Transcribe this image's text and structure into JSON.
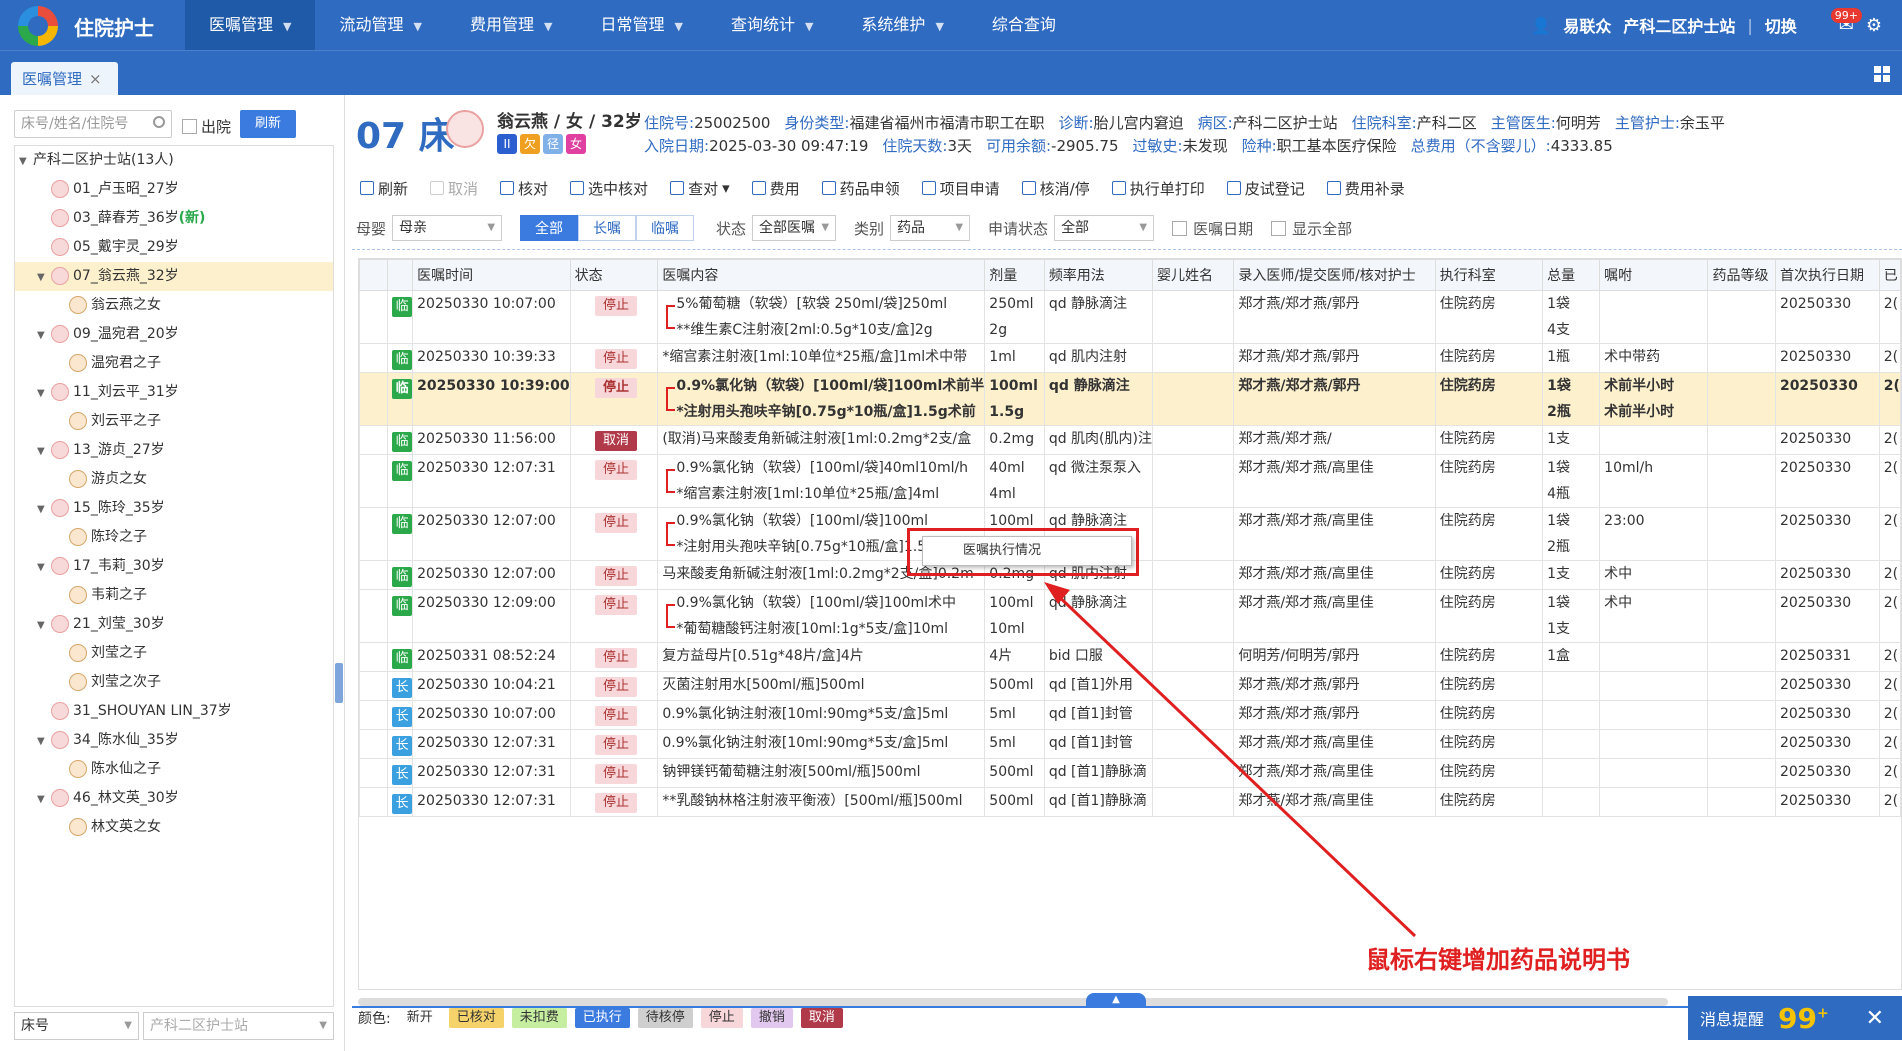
{
  "app": {
    "title": "住院护士",
    "user": "易联众",
    "ward": "产科二区护士站",
    "switch": "切换",
    "sep": "|",
    "msg_badge": "99+"
  },
  "nav": [
    "医嘱管理",
    "流动管理",
    "费用管理",
    "日常管理",
    "查询统计",
    "系统维护",
    "综合查询"
  ],
  "tab": {
    "label": "医嘱管理"
  },
  "sidebar": {
    "search_placeholder": "床号/姓名/住院号",
    "discharge_label": "出院",
    "refresh_label": "刷新",
    "root": "产科二区护士站(13人)",
    "nodes": [
      {
        "label": "01_卢玉昭_27岁",
        "level": 1
      },
      {
        "label": "03_薛春芳_36岁",
        "level": 1,
        "new": "(新)"
      },
      {
        "label": "05_戴宇灵_29岁",
        "level": 1
      },
      {
        "label": "07_翁云燕_32岁",
        "level": 1,
        "expanded": true,
        "selected": true
      },
      {
        "label": "翁云燕之女",
        "level": 2
      },
      {
        "label": "09_温宛君_20岁",
        "level": 1,
        "expanded": true
      },
      {
        "label": "温宛君之子",
        "level": 2
      },
      {
        "label": "11_刘云平_31岁",
        "level": 1,
        "expanded": true
      },
      {
        "label": "刘云平之子",
        "level": 2
      },
      {
        "label": "13_游贞_27岁",
        "level": 1,
        "expanded": true
      },
      {
        "label": "游贞之女",
        "level": 2
      },
      {
        "label": "15_陈玲_35岁",
        "level": 1,
        "expanded": true
      },
      {
        "label": "陈玲之子",
        "level": 2
      },
      {
        "label": "17_韦莉_30岁",
        "level": 1,
        "expanded": true
      },
      {
        "label": "韦莉之子",
        "level": 2
      },
      {
        "label": "21_刘莹_30岁",
        "level": 1,
        "expanded": true
      },
      {
        "label": "刘莹之子",
        "level": 2
      },
      {
        "label": "刘莹之次子",
        "level": 2
      },
      {
        "label": "31_SHOUYAN LIN_37岁",
        "level": 1
      },
      {
        "label": "34_陈水仙_35岁",
        "level": 1,
        "expanded": true
      },
      {
        "label": "陈水仙之子",
        "level": 2
      },
      {
        "label": "46_林文英_30岁",
        "level": 1,
        "expanded": true
      },
      {
        "label": "林文英之女",
        "level": 2
      }
    ],
    "foot_left": "床号",
    "foot_right": "产科二区护士站"
  },
  "patient": {
    "bed": "07 床",
    "name": "翁云燕 / 女 / 32岁",
    "chips": [
      {
        "t": "II",
        "c": "#2b5fd0"
      },
      {
        "t": "欠",
        "c": "#f0a020"
      },
      {
        "t": "径",
        "c": "#7fb0e8"
      },
      {
        "t": "女",
        "c": "#e040a0"
      }
    ],
    "row1": [
      {
        "k": "住院号:",
        "v": "25002500"
      },
      {
        "k": "身份类型:",
        "v": "福建省福州市福清市职工在职"
      },
      {
        "k": "诊断:",
        "v": "胎儿宫内窘迫"
      },
      {
        "k": "病区:",
        "v": "产科二区护士站"
      },
      {
        "k": "住院科室:",
        "v": "产科二区"
      },
      {
        "k": "主管医生:",
        "v": "何明芳"
      },
      {
        "k": "主管护士:",
        "v": "余玉平"
      }
    ],
    "row2": [
      {
        "k": "入院日期:",
        "v": "2025-03-30 09:47:19"
      },
      {
        "k": "住院天数:",
        "v": "3天"
      },
      {
        "k": "可用余额:",
        "v": "-2905.75"
      },
      {
        "k": "过敏史:",
        "v": "未发现"
      },
      {
        "k": "险种:",
        "v": "职工基本医疗保险"
      },
      {
        "k": "总费用（不含婴儿）:",
        "v": "4333.85"
      }
    ]
  },
  "toolbar": [
    "刷新",
    "取消",
    "核对",
    "选中核对",
    "查对",
    "费用",
    "药品申领",
    "项目申请",
    "核消/停",
    "执行单打印",
    "皮试登记",
    "费用补录"
  ],
  "toolbar_disabled": [
    1
  ],
  "toolbar_dropdown": "▾",
  "filters": {
    "mother_label": "母婴",
    "mother_value": "母亲",
    "seg": [
      "全部",
      "长嘱",
      "临嘱"
    ],
    "status_label": "状态",
    "status_value": "全部医嘱",
    "category_label": "类别",
    "category_value": "药品",
    "apply_label": "申请状态",
    "apply_value": "全部",
    "order_date": "医嘱日期",
    "show_all": "显示全部"
  },
  "table": {
    "headers": [
      "",
      "",
      "医嘱时间",
      "状态",
      "医嘱内容",
      "剂量",
      "频率用法",
      "婴儿姓名",
      "录入医师/提交医师/核对护士",
      "执行科室",
      "总量",
      "嘱咐",
      "药品等级",
      "首次执行日期",
      "已"
    ],
    "rows": [
      {
        "type": "临",
        "time": "20250330 10:07:00",
        "status": "停止",
        "content": [
          "5%葡萄糖（软袋）[软袋 250ml/袋]250ml",
          "**维生素C注射液[2ml:0.5g*10支/盒]2g"
        ],
        "dose": [
          "250ml",
          "2g"
        ],
        "freq": "qd 静脉滴注",
        "doc": "郑才燕/郑才燕/郭丹",
        "dept": "住院药房",
        "qty": [
          "1袋",
          "4支"
        ],
        "note": "",
        "first": "20250330",
        "tail": "2("
      },
      {
        "type": "临",
        "time": "20250330 10:39:33",
        "status": "停止",
        "content": [
          "*缩宫素注射液[1ml:10单位*25瓶/盒]1ml术中带"
        ],
        "dose": [
          "1ml"
        ],
        "freq": "qd 肌内注射",
        "doc": "郑才燕/郑才燕/郭丹",
        "dept": "住院药房",
        "qty": [
          "1瓶"
        ],
        "note": "术中带药",
        "first": "20250330",
        "tail": "2("
      },
      {
        "type": "临",
        "time": "20250330 10:39:00",
        "status": "停止",
        "hl": true,
        "content": [
          "0.9%氯化钠（软袋）[100ml/袋]100ml术前半",
          "*注射用头孢呋辛钠[0.75g*10瓶/盒]1.5g术前"
        ],
        "dose": [
          "100ml",
          "1.5g"
        ],
        "freq": "qd 静脉滴注",
        "doc": "郑才燕/郑才燕/郭丹",
        "dept": "住院药房",
        "qty": [
          "1袋",
          "2瓶"
        ],
        "note": "术前半小时",
        "note2": "术前半小时",
        "first": "20250330",
        "tail": "2("
      },
      {
        "type": "临",
        "time": "20250330 11:56:00",
        "status": "取消",
        "content": [
          "(取消)马来酸麦角新碱注射液[1ml:0.2mg*2支/盒"
        ],
        "dose": [
          "0.2mg"
        ],
        "freq": "qd 肌肉(肌内)注",
        "doc": "郑才燕/郑才燕/",
        "dept": "住院药房",
        "qty": [
          "1支"
        ],
        "note": "",
        "first": "20250330",
        "tail": "2("
      },
      {
        "type": "临",
        "time": "20250330 12:07:31",
        "status": "停止",
        "content": [
          "0.9%氯化钠（软袋）[100ml/袋]40ml10ml/h",
          "*缩宫素注射液[1ml:10单位*25瓶/盒]4ml"
        ],
        "dose": [
          "40ml",
          "4ml"
        ],
        "freq": "qd 微注泵泵入",
        "doc": "郑才燕/郑才燕/高里佳",
        "dept": "住院药房",
        "qty": [
          "1袋",
          "4瓶"
        ],
        "note": "10ml/h",
        "first": "20250330",
        "tail": "2("
      },
      {
        "type": "临",
        "time": "20250330 12:07:00",
        "status": "停止",
        "content": [
          "0.9%氯化钠（软袋）[100ml/袋]100ml",
          "*注射用头孢呋辛钠[0.75g*10瓶/盒]1.5g"
        ],
        "dose": [
          "100ml",
          "1.5g"
        ],
        "freq": "qd 静脉滴注",
        "doc": "郑才燕/郑才燕/高里佳",
        "dept": "住院药房",
        "qty": [
          "1袋",
          "2瓶"
        ],
        "note": "23:00",
        "first": "20250330",
        "tail": "2("
      },
      {
        "type": "临",
        "time": "20250330 12:07:00",
        "status": "停止",
        "content": [
          "马来酸麦角新碱注射液[1ml:0.2mg*2支/盒]0.2m"
        ],
        "dose": [
          "0.2mg"
        ],
        "freq": "qd 肌内注射",
        "doc": "郑才燕/郑才燕/高里佳",
        "dept": "住院药房",
        "qty": [
          "1支"
        ],
        "note": "术中",
        "first": "20250330",
        "tail": "2("
      },
      {
        "type": "临",
        "time": "20250330 12:09:00",
        "status": "停止",
        "content": [
          "0.9%氯化钠（软袋）[100ml/袋]100ml术中",
          "*葡萄糖酸钙注射液[10ml:1g*5支/盒]10ml"
        ],
        "dose": [
          "100ml",
          "10ml"
        ],
        "freq": "qd 静脉滴注",
        "doc": "郑才燕/郑才燕/高里佳",
        "dept": "住院药房",
        "qty": [
          "1袋",
          "1支"
        ],
        "note": "术中",
        "first": "20250330",
        "tail": "2("
      },
      {
        "type": "临",
        "time": "20250331 08:52:24",
        "status": "停止",
        "content": [
          "复方益母片[0.51g*48片/盒]4片"
        ],
        "dose": [
          "4片"
        ],
        "freq": "bid 口服",
        "doc": "何明芳/何明芳/郭丹",
        "dept": "住院药房",
        "qty": [
          "1盒"
        ],
        "note": "",
        "first": "20250331",
        "tail": "2("
      },
      {
        "type": "长",
        "time": "20250330 10:04:21",
        "status": "停止",
        "content": [
          "灭菌注射用水[500ml/瓶]500ml"
        ],
        "dose": [
          "500ml"
        ],
        "freq": "qd [首1]外用",
        "doc": "郑才燕/郑才燕/郭丹",
        "dept": "住院药房",
        "qty": [
          ""
        ],
        "note": "",
        "first": "20250330",
        "tail": "2("
      },
      {
        "type": "长",
        "time": "20250330 10:07:00",
        "status": "停止",
        "content": [
          "0.9%氯化钠注射液[10ml:90mg*5支/盒]5ml"
        ],
        "dose": [
          "5ml"
        ],
        "freq": "qd [首1]封管",
        "doc": "郑才燕/郑才燕/郭丹",
        "dept": "住院药房",
        "qty": [
          ""
        ],
        "note": "",
        "first": "20250330",
        "tail": "2("
      },
      {
        "type": "长",
        "time": "20250330 12:07:31",
        "status": "停止",
        "content": [
          "0.9%氯化钠注射液[10ml:90mg*5支/盒]5ml"
        ],
        "dose": [
          "5ml"
        ],
        "freq": "qd [首1]封管",
        "doc": "郑才燕/郑才燕/高里佳",
        "dept": "住院药房",
        "qty": [
          ""
        ],
        "note": "",
        "first": "20250330",
        "tail": "2("
      },
      {
        "type": "长",
        "time": "20250330 12:07:31",
        "status": "停止",
        "content": [
          "钠钾镁钙葡萄糖注射液[500ml/瓶]500ml"
        ],
        "dose": [
          "500ml"
        ],
        "freq": "qd [首1]静脉滴",
        "doc": "郑才燕/郑才燕/高里佳",
        "dept": "住院药房",
        "qty": [
          ""
        ],
        "note": "",
        "first": "20250330",
        "tail": "2("
      },
      {
        "type": "长",
        "time": "20250330 12:07:31",
        "status": "停止",
        "content": [
          "**乳酸钠林格注射液平衡液）[500ml/瓶]500ml"
        ],
        "dose": [
          "500ml"
        ],
        "freq": "qd [首1]静脉滴",
        "doc": "郑才燕/郑才燕/高里佳",
        "dept": "住院药房",
        "qty": [
          ""
        ],
        "note": "",
        "first": "20250330",
        "tail": "2("
      }
    ]
  },
  "legend": {
    "label": "颜色:",
    "items": [
      {
        "t": "新开",
        "bg": "transparent",
        "fg": "#333"
      },
      {
        "t": "已核对",
        "bg": "#f5d36a",
        "fg": "#333"
      },
      {
        "t": "未扣费",
        "bg": "#c5eea0",
        "fg": "#333"
      },
      {
        "t": "已执行",
        "bg": "#3b7be0",
        "fg": "#fff"
      },
      {
        "t": "待核停",
        "bg": "#cfcfcf",
        "fg": "#333"
      },
      {
        "t": "停止",
        "bg": "#f8d7da",
        "fg": "#333"
      },
      {
        "t": "撤销",
        "bg": "#e2c8ee",
        "fg": "#333"
      },
      {
        "t": "取消",
        "bg": "#b03a4a",
        "fg": "#fff"
      }
    ]
  },
  "context_menu": {
    "item": "医嘱执行情况"
  },
  "annotation": "鼠标右键增加药品说明书",
  "message": {
    "label": "消息提醒",
    "count": "99",
    "sup": "+",
    "close": "✕"
  },
  "colors": {
    "primary": "#2f6bc1",
    "annot": "#e02020"
  }
}
